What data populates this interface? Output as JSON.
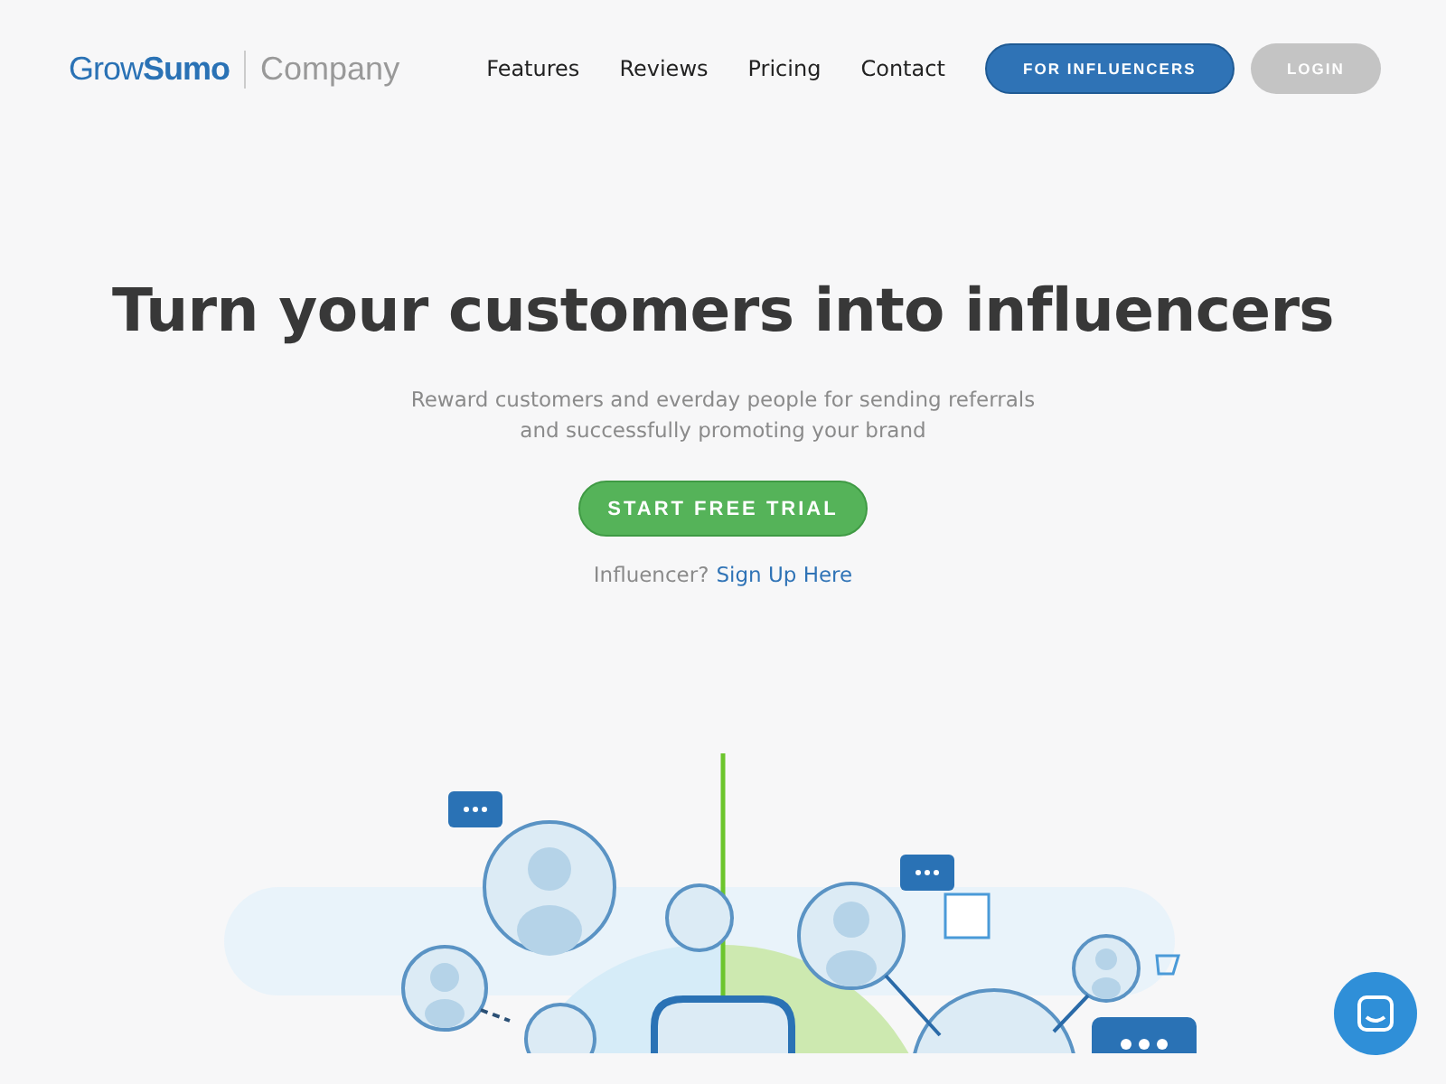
{
  "header": {
    "logo": "Grow**Sumo**",
    "logo_suffix": "Company",
    "nav": [
      "Features",
      "Reviews",
      "Pricing",
      "Contact"
    ],
    "buttons": [
      {
        "label": "FOR INFLUENCERS",
        "kind": "primary"
      },
      {
        "label": "LOGIN",
        "kind": "secondary"
      }
    ]
  },
  "hero": {
    "title": "Turn your customers into influencers",
    "subtitle": "Reward customers and everday people for sending referrals and successfully promoting your brand",
    "cta": "START FREE TRIAL",
    "prompt": "Influencer?",
    "link": "Sign Up Here"
  }
}
